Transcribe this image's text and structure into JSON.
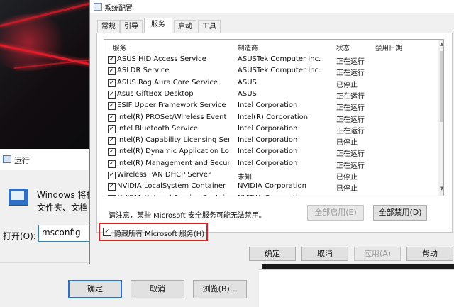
{
  "run": {
    "title": "运行",
    "desc_line1": "Windows 将根",
    "desc_line2": "文件夹、文档",
    "open_label": "打开(O):",
    "open_value": "msconfig",
    "buttons": {
      "ok": "确定",
      "cancel": "取消",
      "browse": "浏览(B)..."
    }
  },
  "msconfig": {
    "title": "系统配置",
    "tabs": [
      "常规",
      "引导",
      "服务",
      "启动",
      "工具"
    ],
    "active_tab": "服务",
    "columns": {
      "service": "服务",
      "manufacturer": "制造商",
      "status": "状态",
      "disabled_date": "禁用日期"
    },
    "services": [
      {
        "name": "ASUS HID Access Service",
        "maker": "ASUSTek Computer Inc.",
        "status": "正在运行"
      },
      {
        "name": "ASLDR Service",
        "maker": "ASUSTek Computer Inc.",
        "status": "正在运行"
      },
      {
        "name": "ASUS Rog Aura Core Service",
        "maker": "ASUS",
        "status": "已停止"
      },
      {
        "name": "Asus GiftBox Desktop",
        "maker": "ASUS",
        "status": "正在运行"
      },
      {
        "name": "ESIF Upper Framework Service",
        "maker": "Intel Corporation",
        "status": "正在运行"
      },
      {
        "name": "Intel(R) PROSet/Wireless Event L...",
        "maker": "Intel(R) Corporation",
        "status": "正在运行"
      },
      {
        "name": "Intel Bluetooth Service",
        "maker": "Intel Corporation",
        "status": "正在运行"
      },
      {
        "name": "Intel(R) Capability Licensing Servi...",
        "maker": "Intel Corporation",
        "status": "已停止"
      },
      {
        "name": "Intel(R) Dynamic Application Loa...",
        "maker": "Intel Corporation",
        "status": "正在运行"
      },
      {
        "name": "Intel(R) Management and Securit...",
        "maker": "Intel Corporation",
        "status": "正在运行"
      },
      {
        "name": "Wireless PAN DHCP Server",
        "maker": "未知",
        "status": "已停止"
      },
      {
        "name": "NVIDIA LocalSystem Container",
        "maker": "NVIDIA Corporation",
        "status": "已停止"
      },
      {
        "name": "NVIDIA NetworkService Container",
        "maker": "NVIDIA Corporation",
        "status": "已停止"
      }
    ],
    "note": "请注意，某些 Microsoft 安全服务可能无法禁用。",
    "enable_all": "全部启用(E)",
    "disable_all": "全部禁用(D)",
    "hide_ms_label": "隐藏所有 Microsoft 服务(H)",
    "buttons": {
      "ok": "确定",
      "cancel": "取消",
      "apply": "应用(A)",
      "help": "帮助"
    }
  },
  "colors": {
    "highlight_border": "#e02020",
    "accent": "#2a72c8"
  }
}
